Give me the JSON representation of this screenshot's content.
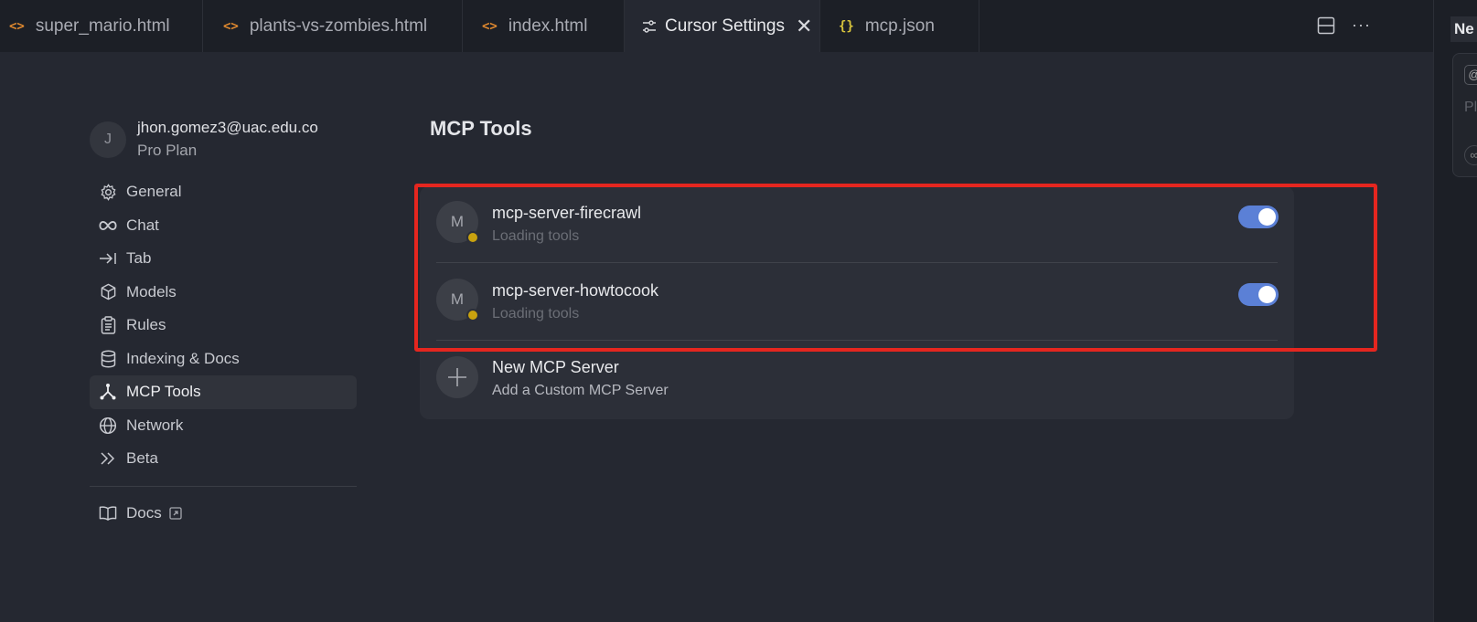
{
  "tabs": [
    {
      "label": "super_mario.html",
      "icon": "code-icon"
    },
    {
      "label": "plants-vs-zombies.html",
      "icon": "code-icon"
    },
    {
      "label": "index.html",
      "icon": "code-icon"
    },
    {
      "label": "Cursor Settings",
      "icon": "settings-sliders-icon",
      "active": true
    },
    {
      "label": "mcp.json",
      "icon": "json-braces-icon"
    }
  ],
  "right_panel": {
    "header": "Ne",
    "placeholder": "Pla"
  },
  "profile": {
    "initial": "J",
    "email": "jhon.gomez3@uac.edu.co",
    "plan": "Pro Plan"
  },
  "nav": [
    {
      "label": "General",
      "icon": "gear-icon"
    },
    {
      "label": "Chat",
      "icon": "infinity-icon"
    },
    {
      "label": "Tab",
      "icon": "arrow-right-bar-icon"
    },
    {
      "label": "Models",
      "icon": "cube-icon"
    },
    {
      "label": "Rules",
      "icon": "clipboard-icon"
    },
    {
      "label": "Indexing & Docs",
      "icon": "database-icon"
    },
    {
      "label": "MCP Tools",
      "icon": "mcp-nodes-icon",
      "active": true
    },
    {
      "label": "Network",
      "icon": "globe-icon"
    },
    {
      "label": "Beta",
      "icon": "double-chevron-icon"
    }
  ],
  "docs": {
    "label": "Docs",
    "icon": "book-icon"
  },
  "main": {
    "title": "MCP Tools",
    "servers": [
      {
        "initial": "M",
        "name": "mcp-server-firecrawl",
        "status": "Loading tools",
        "enabled": true,
        "status_color": "#c9a20f"
      },
      {
        "initial": "M",
        "name": "mcp-server-howtocook",
        "status": "Loading tools",
        "enabled": true,
        "status_color": "#c9a20f"
      }
    ],
    "new_server": {
      "title": "New MCP Server",
      "subtitle": "Add a Custom MCP Server"
    }
  },
  "colors": {
    "toggle_on": "#5b80d6",
    "highlight": "#e5261f",
    "status_loading": "#c9a20f"
  }
}
